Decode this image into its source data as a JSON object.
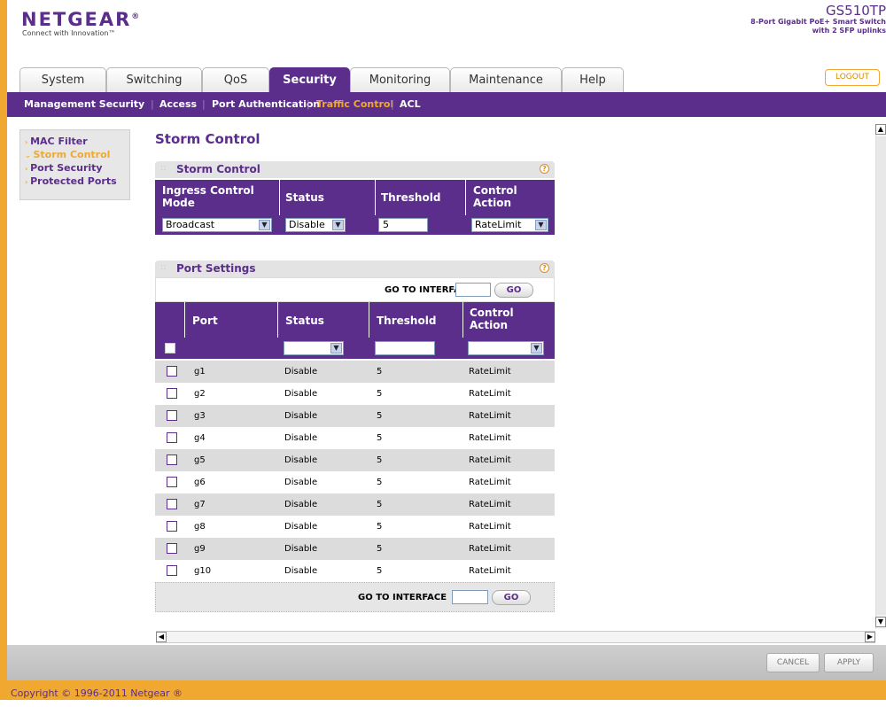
{
  "header": {
    "brand": "NETGEAR",
    "brand_mark": "®",
    "tagline": "Connect with Innovation™",
    "model": "GS510TP",
    "model_desc_1": "8-Port Gigabit PoE+ Smart Switch",
    "model_desc_2": "with 2 SFP uplinks"
  },
  "tabs": [
    {
      "label": "System"
    },
    {
      "label": "Switching"
    },
    {
      "label": "QoS"
    },
    {
      "label": "Security"
    },
    {
      "label": "Monitoring"
    },
    {
      "label": "Maintenance"
    },
    {
      "label": "Help"
    }
  ],
  "logout_label": "LOGOUT",
  "subnav": [
    {
      "label": "Management Security"
    },
    {
      "label": "Access"
    },
    {
      "label": "Port Authentication"
    },
    {
      "label": "Traffic Control"
    },
    {
      "label": "ACL"
    }
  ],
  "leftnav": [
    {
      "label": "MAC Filter"
    },
    {
      "label": "Storm Control"
    },
    {
      "label": "Port Security"
    },
    {
      "label": "Protected Ports"
    }
  ],
  "page_title": "Storm Control",
  "storm_section": {
    "title": "Storm Control",
    "headers": {
      "mode_1": "Ingress Control",
      "mode_2": "Mode",
      "status": "Status",
      "threshold": "Threshold",
      "action_1": "Control",
      "action_2": "Action"
    },
    "mode_value": "Broadcast",
    "status_value": "Disable",
    "threshold_value": "5",
    "action_value": "RateLimit"
  },
  "port_section": {
    "title": "Port Settings",
    "goto_label": "GO TO INTERFACE",
    "go_label": "GO",
    "headers": {
      "port": "Port",
      "status": "Status",
      "threshold": "Threshold",
      "action_1": "Control",
      "action_2": "Action"
    },
    "rows": [
      {
        "port": "g1",
        "status": "Disable",
        "threshold": "5",
        "action": "RateLimit"
      },
      {
        "port": "g2",
        "status": "Disable",
        "threshold": "5",
        "action": "RateLimit"
      },
      {
        "port": "g3",
        "status": "Disable",
        "threshold": "5",
        "action": "RateLimit"
      },
      {
        "port": "g4",
        "status": "Disable",
        "threshold": "5",
        "action": "RateLimit"
      },
      {
        "port": "g5",
        "status": "Disable",
        "threshold": "5",
        "action": "RateLimit"
      },
      {
        "port": "g6",
        "status": "Disable",
        "threshold": "5",
        "action": "RateLimit"
      },
      {
        "port": "g7",
        "status": "Disable",
        "threshold": "5",
        "action": "RateLimit"
      },
      {
        "port": "g8",
        "status": "Disable",
        "threshold": "5",
        "action": "RateLimit"
      },
      {
        "port": "g9",
        "status": "Disable",
        "threshold": "5",
        "action": "RateLimit"
      },
      {
        "port": "g10",
        "status": "Disable",
        "threshold": "5",
        "action": "RateLimit"
      }
    ]
  },
  "footer": {
    "cancel_label": "CANCEL",
    "apply_label": "APPLY",
    "copyright": "Copyright © 1996-2011 Netgear ®"
  },
  "colors": {
    "brand_purple": "#5a2e8a",
    "accent_orange": "#f0a830"
  }
}
